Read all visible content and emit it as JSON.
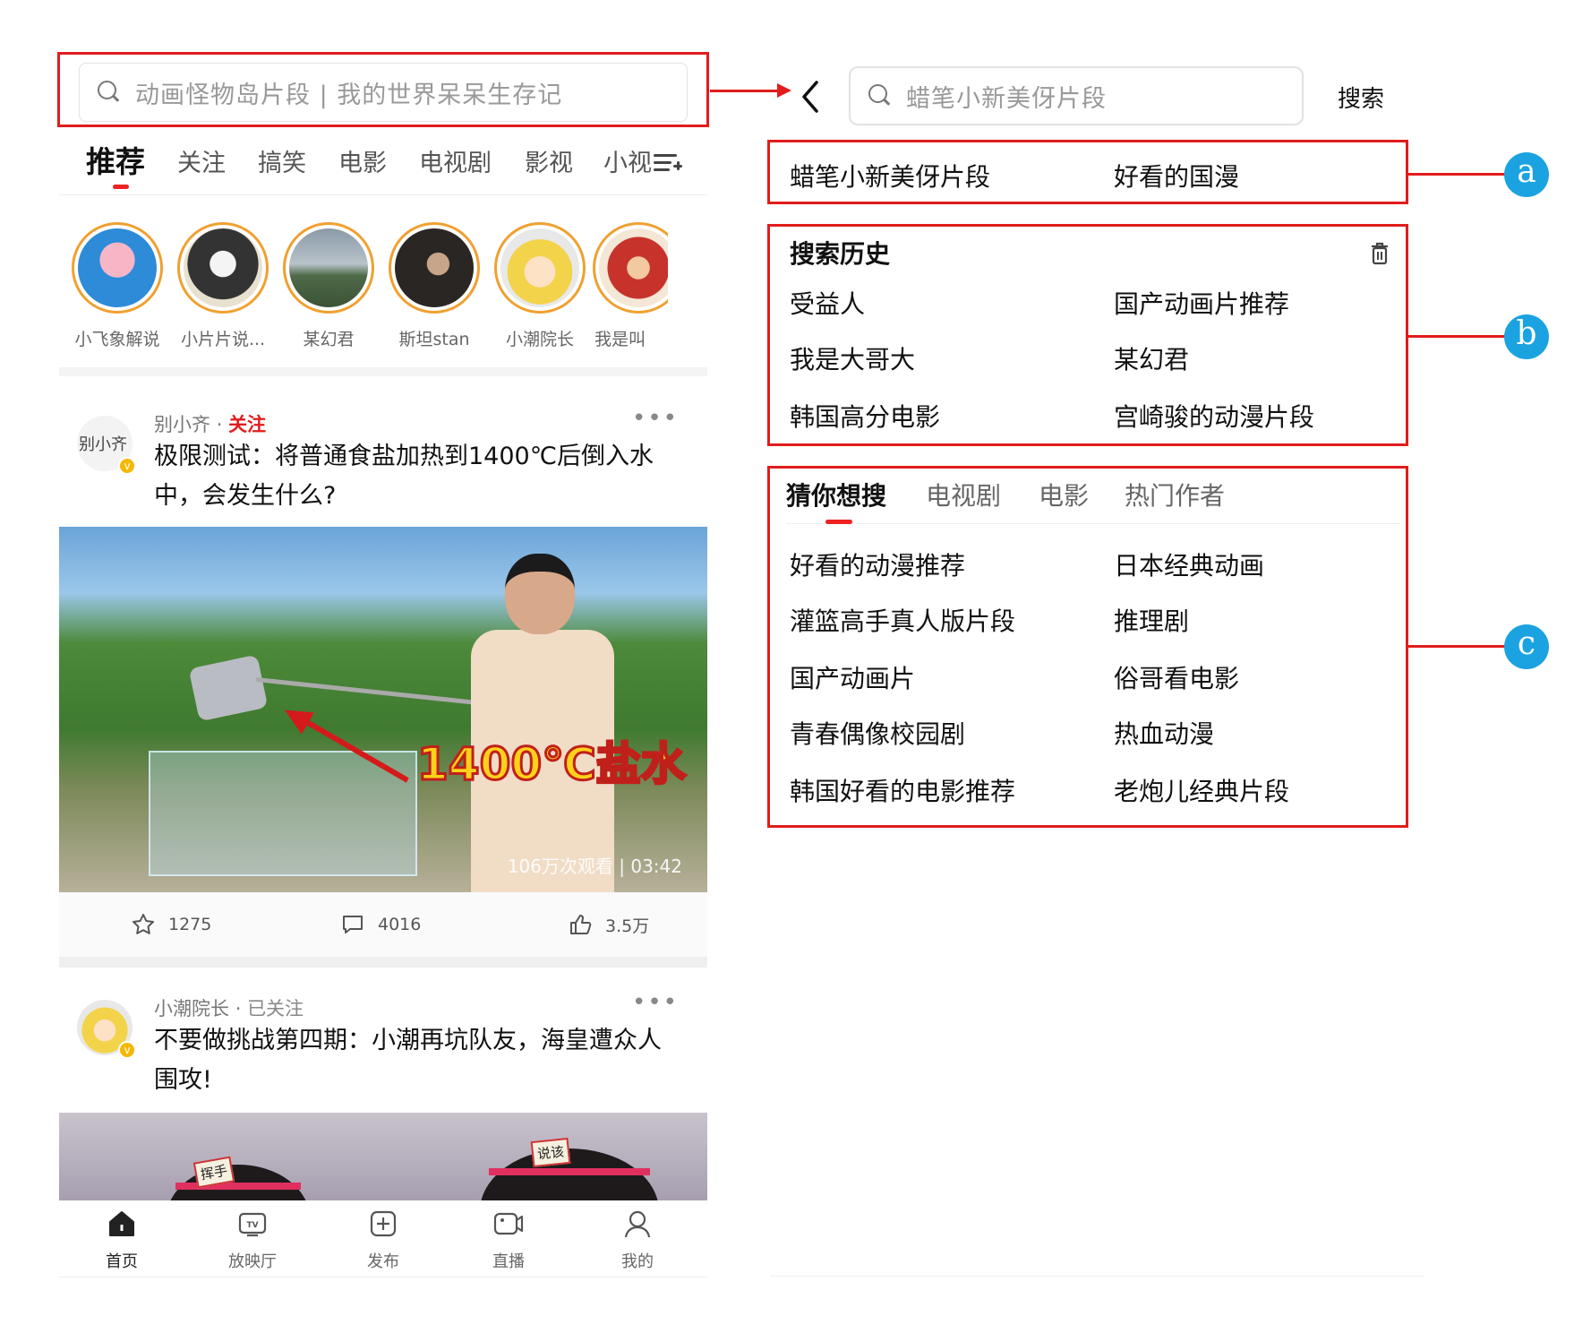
{
  "home": {
    "search_placeholder": "动画怪物岛片段 | 我的世界呆呆生存记",
    "tabs": [
      "推荐",
      "关注",
      "搞笑",
      "电影",
      "电视剧",
      "影视",
      "小视"
    ],
    "following": [
      "小飞象解说",
      "小片片说...",
      "某幻君",
      "斯坦stan",
      "小潮院长",
      "我是叫"
    ],
    "post1": {
      "author": "别小齐",
      "dot": "·",
      "follow": "关注",
      "more": "•••",
      "avatar_text": "别小齐",
      "title": "极限测试：将普通食盐加热到1400℃后倒入水中，会发生什么?",
      "video_caption": "1400℃盐水",
      "video_meta": "106万次观看 | 03:42",
      "stars": "1275",
      "comments": "4016",
      "likes": "3.5万"
    },
    "post2": {
      "author": "小潮院长",
      "dot": "·",
      "follow": "已关注",
      "more": "•••",
      "title": "不要做挑战第四期：小潮再坑队友，海皇遭众人围攻!",
      "card1": "挥手",
      "card2": "说该"
    },
    "nav": [
      "首页",
      "放映厅",
      "发布",
      "直播",
      "我的"
    ]
  },
  "search_page": {
    "query": "蜡笔小新美伢片段",
    "search_label": "搜索",
    "suggestions": [
      "蜡笔小新美伢片段",
      "好看的国漫"
    ],
    "history_title": "搜索历史",
    "history": [
      "受益人",
      "国产动画片推荐",
      "我是大哥大",
      "某幻君",
      "韩国高分电影",
      "宫崎骏的动漫片段"
    ],
    "guess_tabs": [
      "猜你想搜",
      "电视剧",
      "电影",
      "热门作者"
    ],
    "guess": [
      "好看的动漫推荐",
      "日本经典动画",
      "灌篮高手真人版片段",
      "推理剧",
      "国产动画片",
      "俗哥看电影",
      "青春偶像校园剧",
      "热血动漫",
      "韩国好看的电影推荐",
      "老炮儿经典片段"
    ]
  },
  "callouts": [
    "a",
    "b",
    "c"
  ],
  "colors": {
    "annotation_red": "#e11c1c",
    "badge_blue": "#1aa3e0",
    "accent_red": "#e22222",
    "verified_gold": "#f5b800"
  },
  "icons": [
    "search-icon",
    "menu-add-icon",
    "more-icon",
    "star-icon",
    "comment-icon",
    "thumbs-up-icon",
    "home-icon",
    "tv-icon",
    "plus-icon",
    "camera-icon",
    "user-icon",
    "back-arrow-icon",
    "trash-icon"
  ]
}
